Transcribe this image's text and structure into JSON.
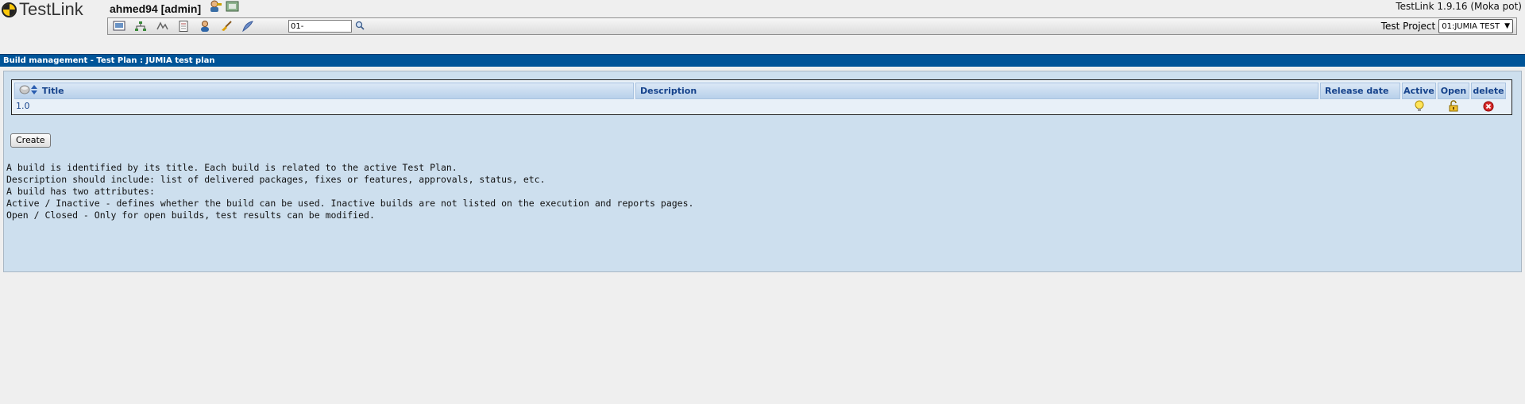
{
  "app": {
    "logo_text": "TestLink",
    "user": "ahmed94 [admin]",
    "version": "TestLink 1.9.16 (Moka pot)"
  },
  "toolbar": {
    "icons": [
      "desktop-icon",
      "sitemap-icon",
      "events-icon",
      "document-icon",
      "user-icon",
      "broom-icon",
      "feather-icon"
    ],
    "tc_search_value": "01-",
    "project_label": "Test Project",
    "project_value": "01:JUMIA TEST"
  },
  "page": {
    "title": "Build management - Test Plan : JUMIA test plan"
  },
  "table": {
    "columns": [
      "Title",
      "Description",
      "Release date",
      "Active",
      "Open",
      "delete"
    ],
    "rows": [
      {
        "title": "1.0",
        "description": "",
        "release_date": ""
      }
    ]
  },
  "create_label": "Create",
  "help_lines": [
    "A build is identified by its title. Each build is related to the active Test Plan.",
    "Description should include: list of delivered packages, fixes or features, approvals, status, etc.",
    "A build has two attributes:",
    "Active / Inactive - defines whether the build can be used. Inactive builds are not listed on the execution and reports pages.",
    "Open / Closed - Only for open builds, test results can be modified."
  ],
  "colors": {
    "title_bar": "#005498",
    "workframe": "#cddfee",
    "header_text": "#15428b"
  }
}
